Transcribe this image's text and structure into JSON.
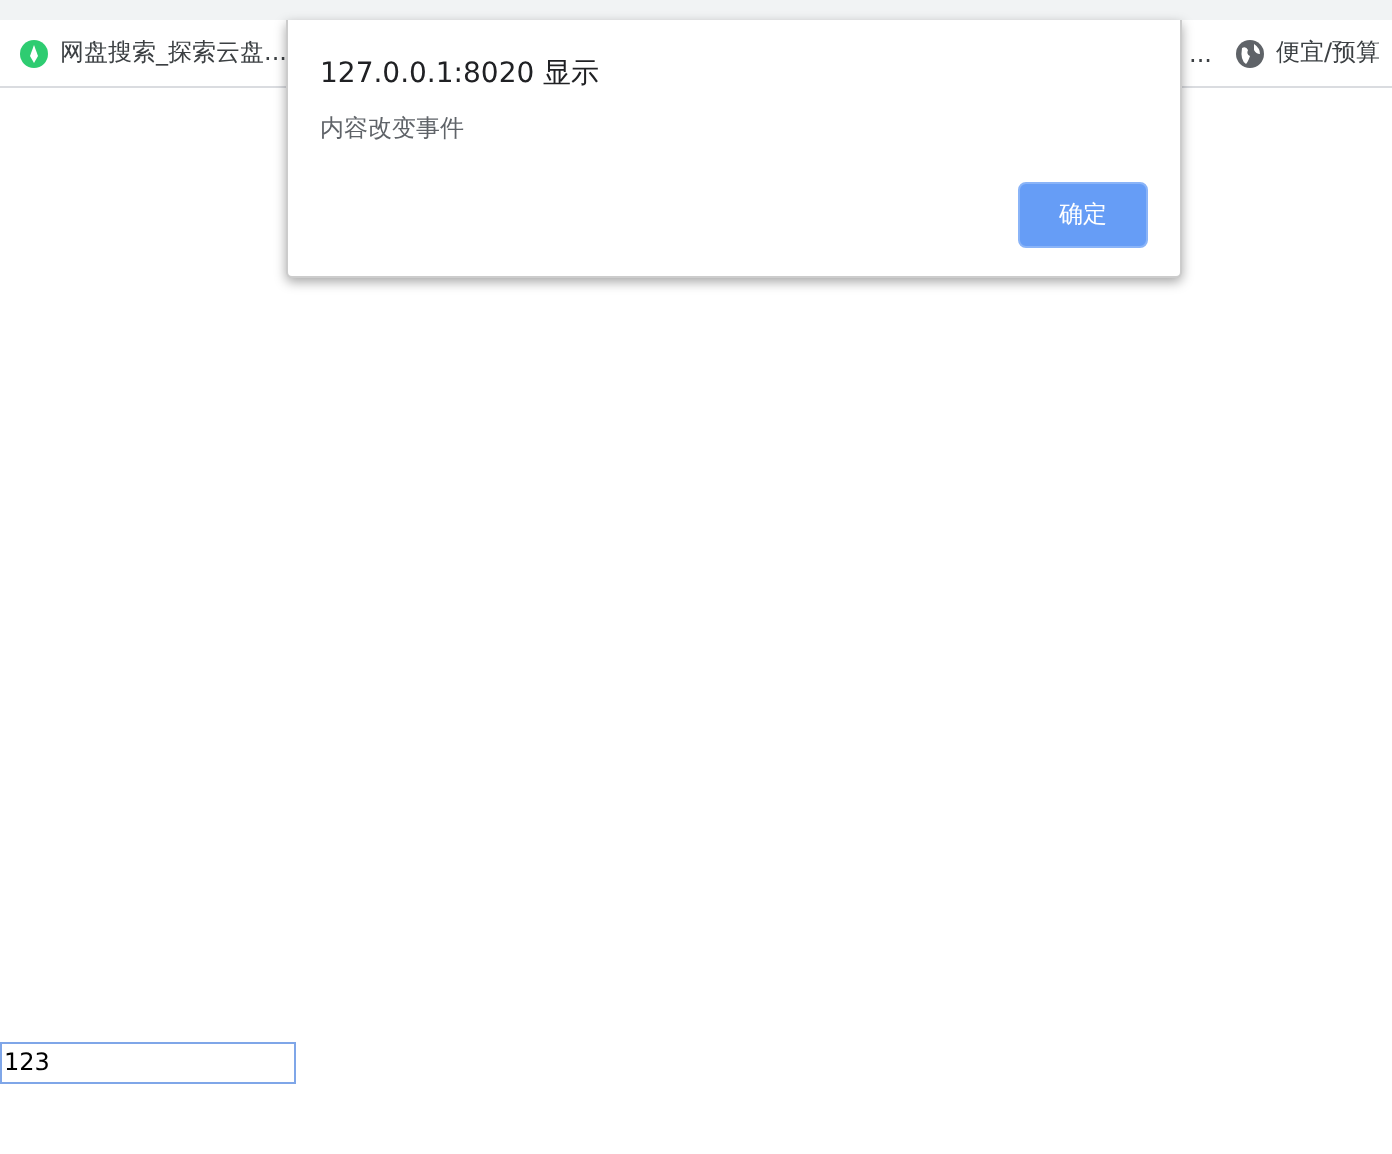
{
  "bookmarks": [
    {
      "kind": "app",
      "label": "网盘搜索_探索云盘..."
    },
    {
      "kind": "text",
      "label": "..."
    },
    {
      "kind": "globe",
      "label": "便宜/预算"
    }
  ],
  "dialog": {
    "title": "127.0.0.1:8020 显示",
    "message": "内容改变事件",
    "buttons": [
      "确定"
    ]
  },
  "input": {
    "value": "123"
  }
}
